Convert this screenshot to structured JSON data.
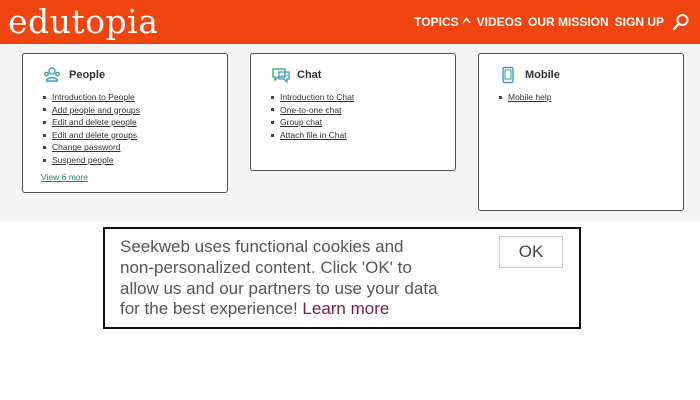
{
  "header": {
    "logo": "edutopia",
    "nav": [
      {
        "label": "TOPICS",
        "has_caret": true,
        "caret": "^"
      },
      {
        "label": "VIDEOS"
      },
      {
        "label": "OUR MISSION"
      },
      {
        "label": "SIGN UP"
      }
    ],
    "search_icon": "search-icon",
    "brand_color": "#f0450e"
  },
  "cards": {
    "people": {
      "title": "People",
      "icon": "people-icon",
      "items": [
        "Introduction to People",
        "Add people and groups",
        "Edit and delete people",
        "Edit and delete groups",
        "Change password",
        "Suspend people"
      ],
      "view_more": "View 6 more"
    },
    "chat": {
      "title": "Chat",
      "icon": "chat-icon",
      "items": [
        "Introduction to Chat",
        "One-to-one chat",
        "Group chat",
        "Attach file in Chat"
      ]
    },
    "mobile": {
      "title": "Mobile",
      "icon": "mobile-icon",
      "items": [
        "Mobile help"
      ]
    }
  },
  "cookie": {
    "text": "Seekweb uses functional cookies and non-personalized content. Click 'OK' to allow us and our partners to use your data for the best experience!",
    "learn_more": "Learn more",
    "ok_label": "OK",
    "learn_more_color": "#7a1a48"
  }
}
